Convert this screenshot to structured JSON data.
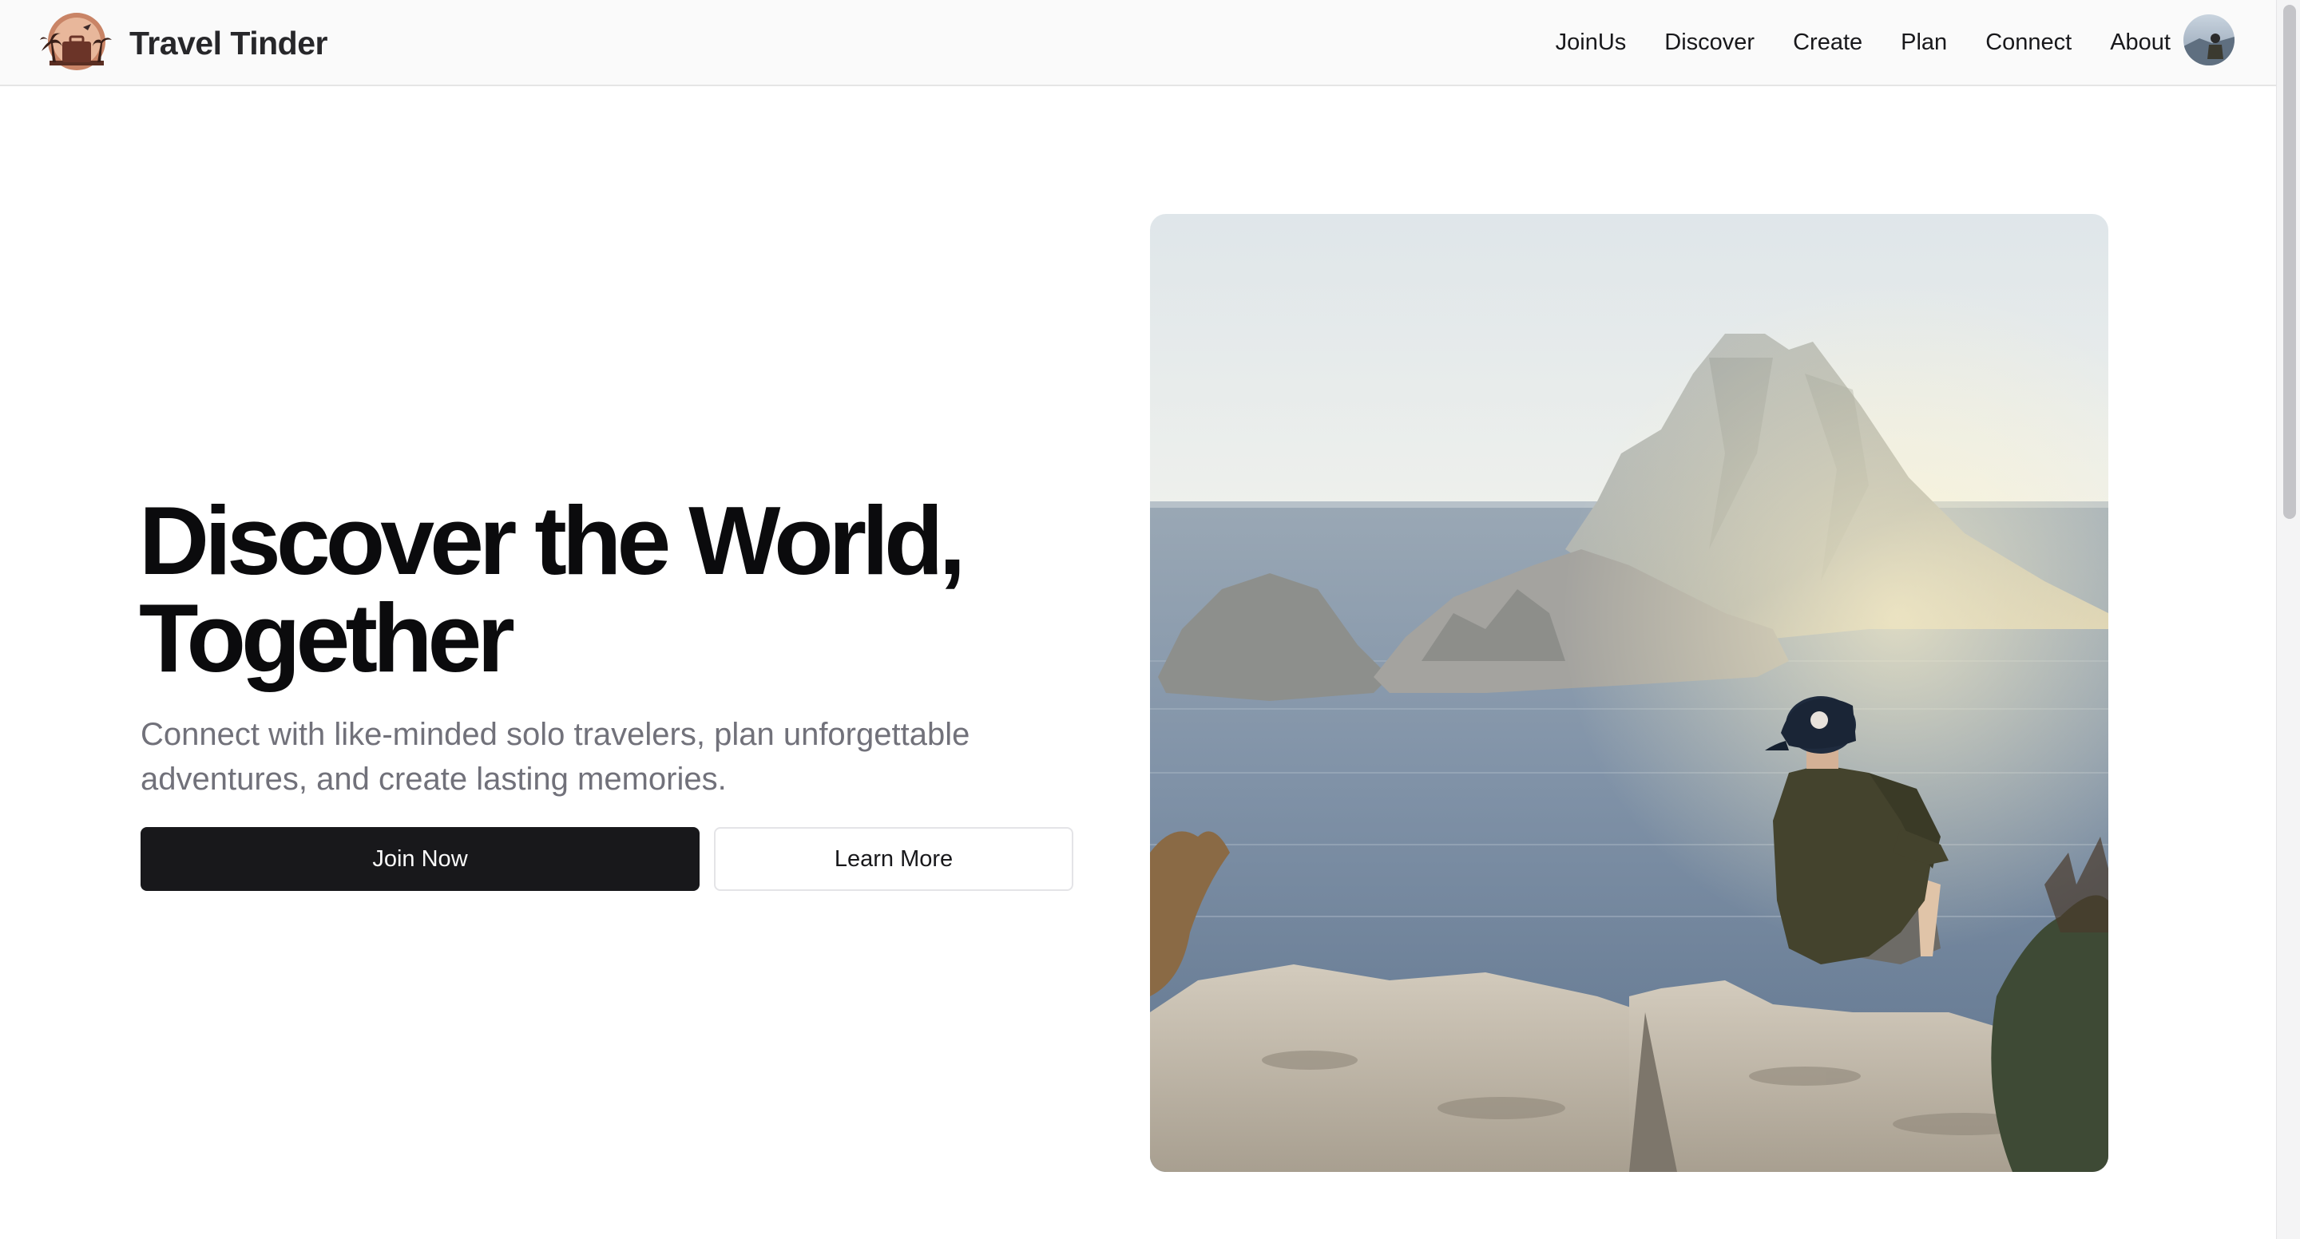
{
  "header": {
    "brand_name": "Travel Tinder",
    "logo_icon": "palm-suitcase-logo-icon",
    "nav_items": [
      {
        "label": "JoinUs"
      },
      {
        "label": "Discover"
      },
      {
        "label": "Create"
      },
      {
        "label": "Plan"
      },
      {
        "label": "Connect"
      },
      {
        "label": "About"
      }
    ],
    "avatar_icon": "user-avatar"
  },
  "hero": {
    "title_line1": "Discover the World,",
    "title_line2": "Together",
    "subtitle": "Connect with like-minded solo travelers, plan unforgettable adventures, and create lasting memories.",
    "primary_button": "Join Now",
    "secondary_button": "Learn More",
    "image_icon": "traveler-on-cliff-photo"
  },
  "colors": {
    "primary_button_bg": "#18181b",
    "header_bg": "#fafafa",
    "subtitle_text": "#71717a"
  }
}
